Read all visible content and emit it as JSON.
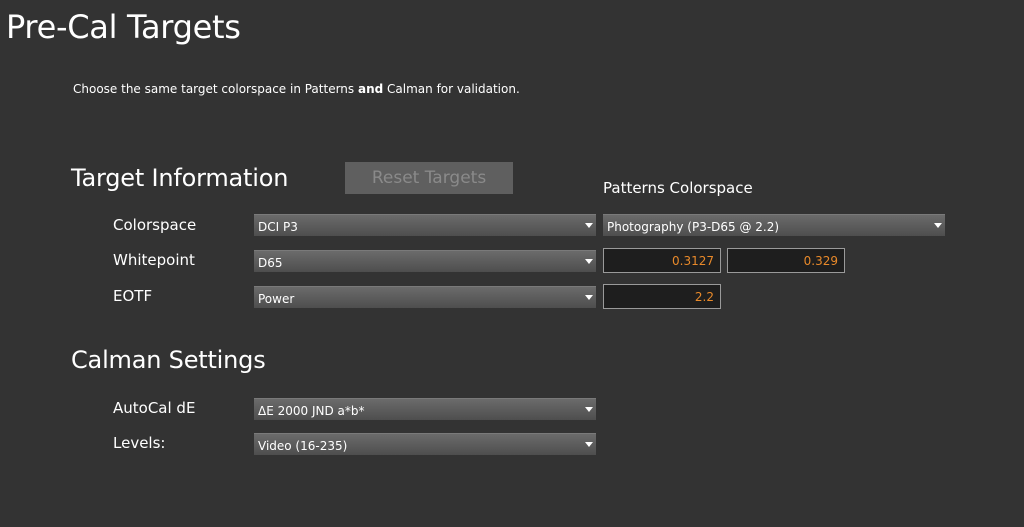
{
  "page": {
    "title": "Pre-Cal Targets",
    "instructions_before": "Choose the same target colorspace in Patterns ",
    "instructions_bold": "and",
    "instructions_after": " Calman for validation."
  },
  "target_information": {
    "title": "Target Information",
    "reset_button": "Reset Targets",
    "patterns_header": "Patterns Colorspace",
    "rows": {
      "colorspace": {
        "label": "Colorspace",
        "value": "DCI P3",
        "patterns_value": "Photography (P3-D65 @ 2.2)"
      },
      "whitepoint": {
        "label": "Whitepoint",
        "value": "D65",
        "x": "0.3127",
        "y": "0.329"
      },
      "eotf": {
        "label": "EOTF",
        "value": "Power",
        "gamma": "2.2"
      }
    }
  },
  "calman_settings": {
    "title": "Calman Settings",
    "rows": {
      "autocal": {
        "label": "AutoCal dE",
        "value": "ΔE 2000 JND a*b*"
      },
      "levels": {
        "label": "Levels:",
        "value": "Video (16-235)"
      }
    }
  },
  "colors": {
    "background": "#333333",
    "field_value": "#e8892a",
    "reset_disabled_text": "#8a8a8a"
  },
  "icons": {
    "dropdown_arrow": "chevron-down-icon"
  }
}
